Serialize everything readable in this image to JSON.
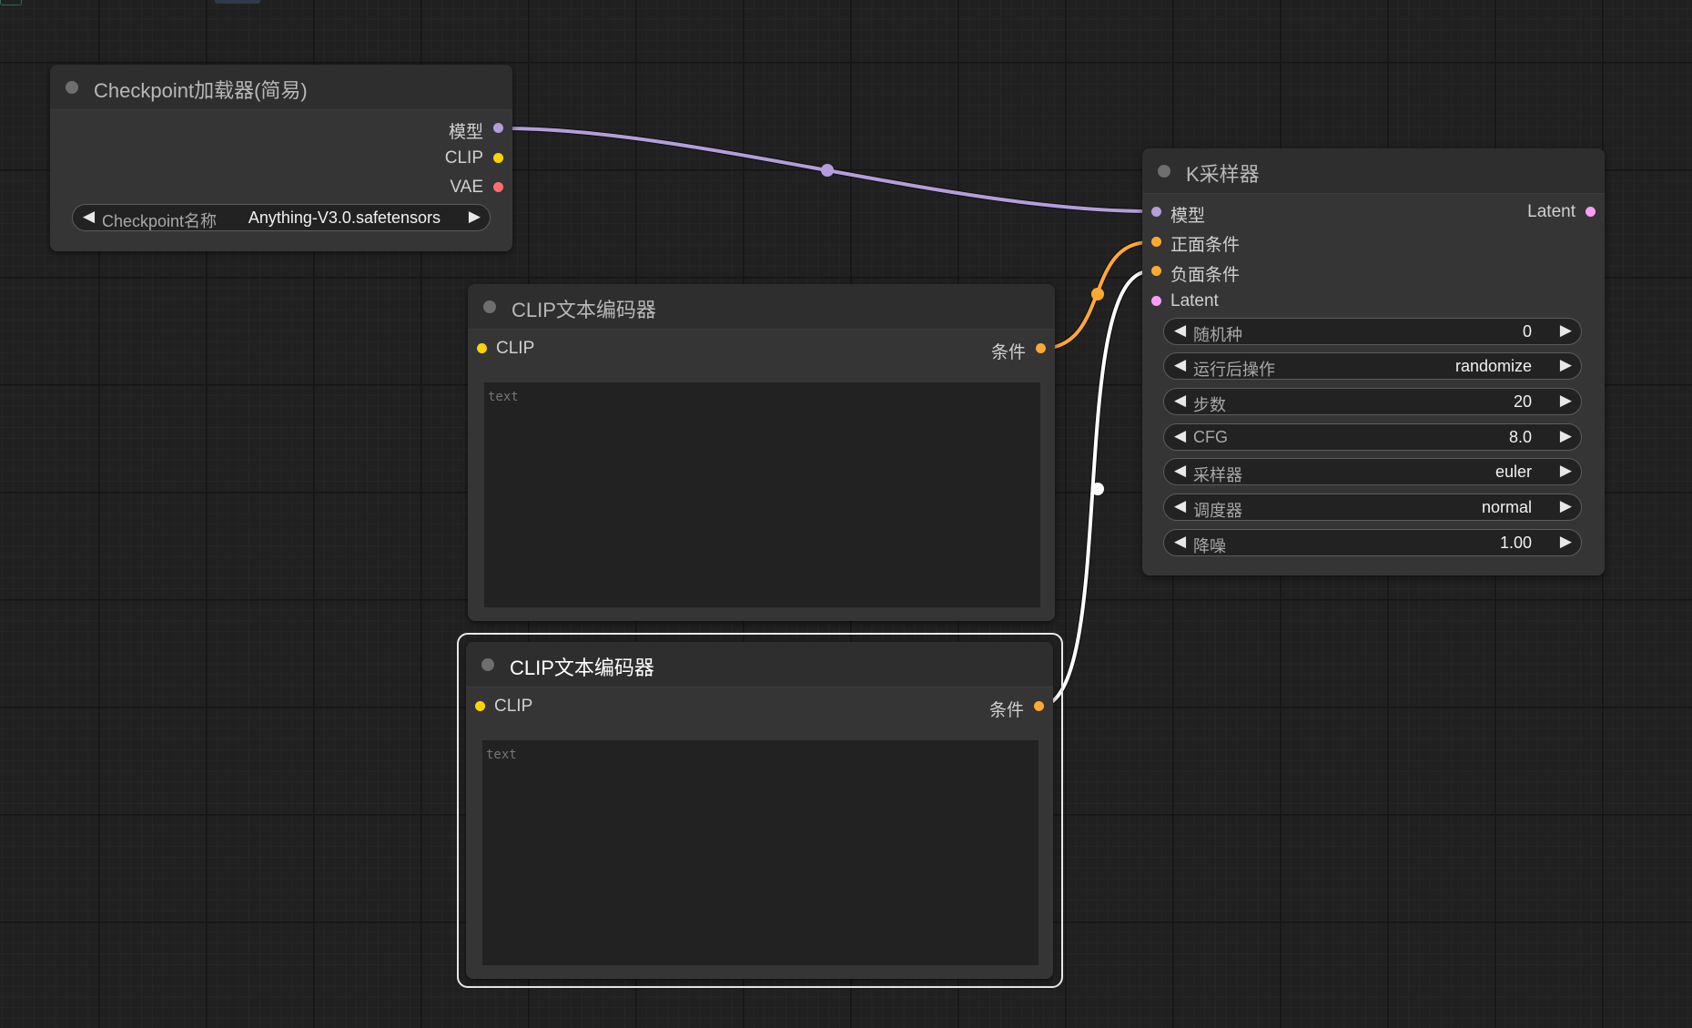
{
  "colors": {
    "model": "#b39ddb",
    "clip": "#ffd500",
    "vae": "#ff6e6e",
    "conditioning": "#ffa931",
    "latent": "#ff9cf9",
    "neg_link": "#ffffff",
    "background": "#202020"
  },
  "nodes": {
    "checkpoint_loader": {
      "title": "Checkpoint加载器(简易)",
      "outputs": [
        {
          "label": "模型",
          "type": "MODEL"
        },
        {
          "label": "CLIP",
          "type": "CLIP"
        },
        {
          "label": "VAE",
          "type": "VAE"
        }
      ],
      "widget": {
        "label": "Checkpoint名称",
        "value": "Anything-V3.0.safetensors"
      }
    },
    "clip_encoder_1": {
      "title": "CLIP文本编码器",
      "input_label": "CLIP",
      "output_label": "条件",
      "text_placeholder": "text",
      "text_value": ""
    },
    "clip_encoder_2": {
      "title": "CLIP文本编码器",
      "input_label": "CLIP",
      "output_label": "条件",
      "text_placeholder": "text",
      "text_value": "",
      "selected": true
    },
    "ksampler": {
      "title": "K采样器",
      "inputs": [
        {
          "label": "模型",
          "type": "MODEL"
        },
        {
          "label": "正面条件",
          "type": "CONDITIONING"
        },
        {
          "label": "负面条件",
          "type": "CONDITIONING"
        },
        {
          "label": "Latent",
          "type": "LATENT"
        }
      ],
      "output_label": "Latent",
      "widgets": [
        {
          "label": "随机种",
          "value": "0"
        },
        {
          "label": "运行后操作",
          "value": "randomize"
        },
        {
          "label": "步数",
          "value": "20"
        },
        {
          "label": "CFG",
          "value": "8.0"
        },
        {
          "label": "采样器",
          "value": "euler"
        },
        {
          "label": "调度器",
          "value": "normal"
        },
        {
          "label": "降噪",
          "value": "1.00"
        }
      ]
    }
  },
  "arrows": {
    "left": "◀",
    "right": "▶"
  }
}
